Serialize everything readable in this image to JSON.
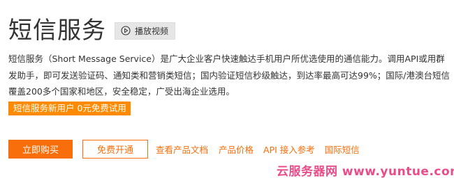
{
  "header": {
    "title": "短信服务",
    "video_button_label": "播放视频",
    "video_icon": "play-circle-icon"
  },
  "description": "短信服务（Short Message Service）是广大企业客户快速触达手机用户所优选使用的通信能力。调用API或用群发助手，即可发送验证码、通知类和营销类短信；国内验证短信秒级触达，到达率最高可达99%；国际/港澳台短信覆盖200多个国家和地区，安全稳定，广受出海企业选用。",
  "promo": {
    "label": "短信服务新用户 0元免费试用"
  },
  "actions": {
    "buy_now": "立即购买",
    "free_activate": "免费开通",
    "view_docs": "查看产品文档",
    "pricing": "产品价格",
    "api_reference": "API 接入参考",
    "international_sms": "国际短信"
  },
  "watermark": {
    "text": "云服务器网 www.yuntue.com"
  },
  "colors": {
    "accent": "#f76e0a",
    "promo_background": "#ff8a00",
    "watermark": "#e84d8a",
    "text": "#333333"
  }
}
